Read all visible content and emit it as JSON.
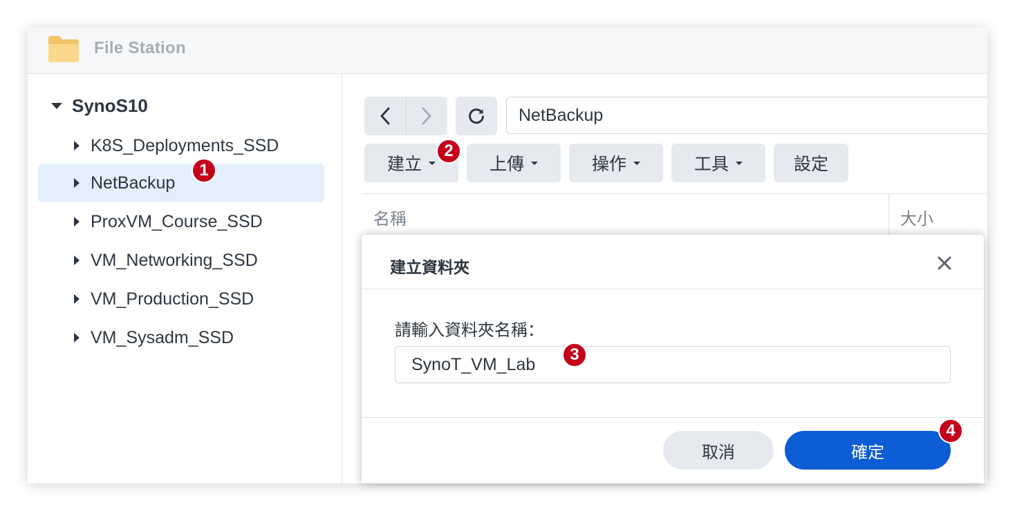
{
  "window": {
    "title": "File Station",
    "icon": "folder-icon"
  },
  "sidebar": {
    "root": "SynoS10",
    "items": [
      {
        "label": "K8S_Deployments_SSD"
      },
      {
        "label": "NetBackup",
        "selected": true
      },
      {
        "label": "ProxVM_Course_SSD"
      },
      {
        "label": "VM_Networking_SSD"
      },
      {
        "label": "VM_Production_SSD"
      },
      {
        "label": "VM_Sysadm_SSD"
      }
    ]
  },
  "toolbar": {
    "path": "NetBackup",
    "create": "建立",
    "upload": "上傳",
    "action": "操作",
    "tools": "工具",
    "settings": "設定"
  },
  "columns": {
    "name": "名稱",
    "size": "大小"
  },
  "dialog": {
    "title": "建立資料夾",
    "prompt": "請輸入資料夾名稱：",
    "value": "SynoT_VM_Lab",
    "cancel": "取消",
    "ok": "確定"
  },
  "badges": [
    "1",
    "2",
    "3",
    "4"
  ],
  "colors": {
    "accent": "#0b5cd5",
    "selection": "#e3effb",
    "badge": "#c4001a"
  }
}
